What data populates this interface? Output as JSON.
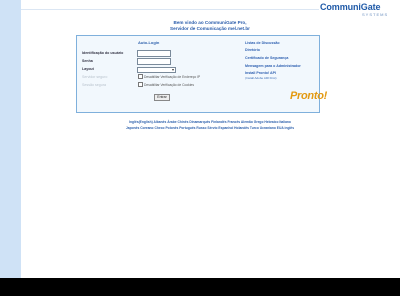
{
  "brand": {
    "name": "CommuniGate",
    "sub": "SYSTEMS"
  },
  "welcome": {
    "line1": "Bem vindo ao CommuniGate Pro,",
    "line2": "Servidor de Comunicação mel.net.br"
  },
  "login": {
    "title": "Auto-Login",
    "user_label": "Identificação do usuário",
    "password_label": "Senha",
    "layout_label": "Layout",
    "disabled_label1": "Servidor seguro",
    "disabled_label2": "Sessão segura",
    "check1_label": "Desabilitar Verificação de Endereço IP",
    "check2_label": "Desabilitar Verificação de Cookies",
    "submit_label": "Entrar",
    "user_value": "",
    "password_value": "",
    "layout_value": ""
  },
  "links": {
    "list": "Listas de Discussão",
    "directory": "Diretório",
    "cert": "Certificado de Segurança",
    "admin": "Mensagem para o Administrador",
    "install": "Install Pronto! API",
    "install_sub": "(Install Adobe AIR First)"
  },
  "pronto_logo": "Pronto!",
  "languages": {
    "row1": "Inglês(English) Albanês Árabe Chinês Dinamarquês Finlandês Francês Alemão Grego Hebraico Italiano",
    "row2": "Japonês Coreano Checo Polonês Português Russo Sérvio Espanhol Holandês Turco Ucraniano EUA inglês"
  },
  "colors": {
    "accent": "#2a5cab",
    "panel_border": "#7fb0dc",
    "pronto": "#e39a12"
  }
}
